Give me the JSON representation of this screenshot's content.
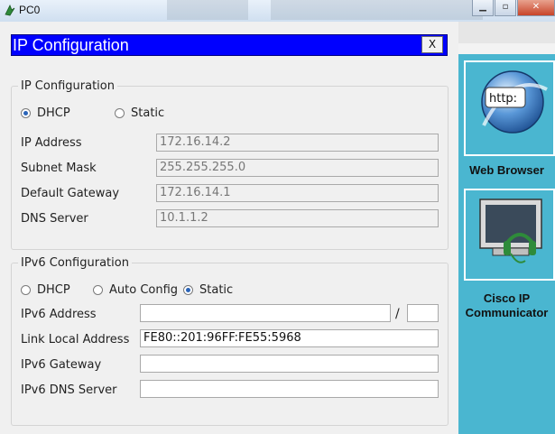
{
  "window": {
    "title": "PC0"
  },
  "dialog": {
    "title": "IP Configuration",
    "close_label": "X"
  },
  "ipv4": {
    "legend": "IP Configuration",
    "mode_dhcp": "DHCP",
    "mode_static": "Static",
    "selected": "DHCP",
    "ip_label": "IP Address",
    "ip_value": "172.16.14.2",
    "mask_label": "Subnet Mask",
    "mask_value": "255.255.255.0",
    "gw_label": "Default Gateway",
    "gw_value": "172.16.14.1",
    "dns_label": "DNS Server",
    "dns_value": "10.1.1.2"
  },
  "ipv6": {
    "legend": "IPv6 Configuration",
    "mode_dhcp": "DHCP",
    "mode_auto": "Auto Config",
    "mode_static": "Static",
    "selected": "Static",
    "addr_label": "IPv6 Address",
    "addr_value": "",
    "prefix_sep": "/",
    "prefix_value": "",
    "link_local_label": "Link Local Address",
    "link_local_value": "FE80::201:96FF:FE55:5968",
    "gw_label": "IPv6 Gateway",
    "gw_value": "",
    "dns_label": "IPv6 DNS Server",
    "dns_value": ""
  },
  "desktop": {
    "apps": [
      {
        "label": "Web Browser",
        "icon": "web-browser-icon",
        "icon_text": "http:"
      },
      {
        "label": "Cisco IP Communicator",
        "icon": "ip-communicator-icon"
      }
    ]
  }
}
